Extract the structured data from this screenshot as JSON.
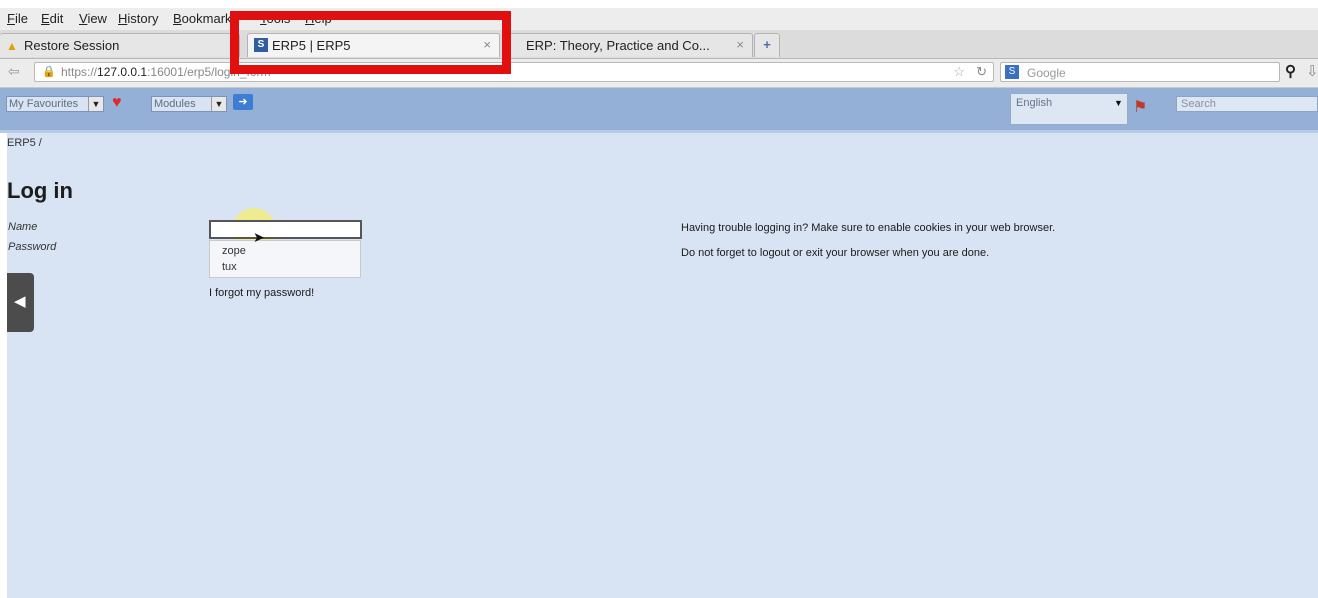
{
  "browser": {
    "menu": [
      "File",
      "Edit",
      "View",
      "History",
      "Bookmarks",
      "Tools",
      "Help"
    ],
    "tabs": [
      {
        "label": "Restore Session",
        "icon": "warning-icon"
      },
      {
        "label": "ERP5 | ERP5",
        "icon": "erp5-favicon",
        "favicon_letter": "S"
      },
      {
        "label": "ERP: Theory, Practice and Co...",
        "icon": "erp5-favicon"
      }
    ],
    "new_tab": "+",
    "close_glyph": "×",
    "url_prefix": "https://",
    "url_host": "127.0.0.1",
    "url_rest": ":16001/erp5/login_form",
    "search_engine": "Google"
  },
  "erp_header": {
    "favourites_label": "My Favourites",
    "modules_label": "Modules",
    "language": "English",
    "search_placeholder": "Search"
  },
  "login": {
    "breadcrumb": "ERP5 /",
    "title": "Log in",
    "name_label": "Name",
    "password_label": "Password",
    "name_value": "",
    "autocomplete": [
      "zope",
      "tux"
    ],
    "forgot_link": "I forgot my password!",
    "help_trouble": "Having trouble logging in? Make sure to enable cookies in your web browser.",
    "help_logout": "Do not forget to logout or exit your browser when you are done."
  },
  "colors": {
    "header_bg": "#95b0d6",
    "content_bg": "#d8e4f4",
    "annotation": "#e01010",
    "highlight": "#faee5a"
  }
}
